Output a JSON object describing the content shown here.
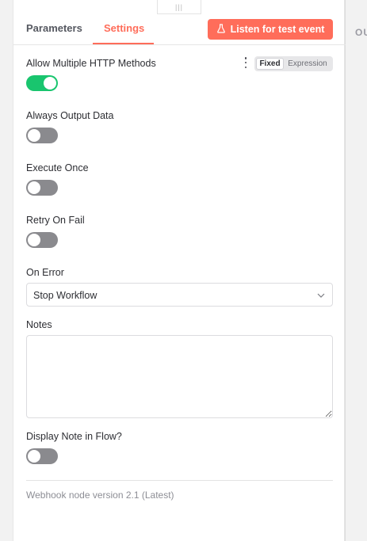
{
  "tabs": {
    "parameters": "Parameters",
    "settings": "Settings"
  },
  "listen_button": {
    "label": "Listen for test event",
    "icon": "flask-icon"
  },
  "mode_switch": {
    "fixed": "Fixed",
    "expression": "Expression",
    "selected": "Fixed"
  },
  "settings": {
    "allow_multiple_http_methods": {
      "label": "Allow Multiple HTTP Methods",
      "enabled": true
    },
    "always_output_data": {
      "label": "Always Output Data",
      "enabled": false
    },
    "execute_once": {
      "label": "Execute Once",
      "enabled": false
    },
    "retry_on_fail": {
      "label": "Retry On Fail",
      "enabled": false
    },
    "on_error": {
      "label": "On Error",
      "value": "Stop Workflow"
    },
    "notes": {
      "label": "Notes",
      "value": ""
    },
    "display_note_in_flow": {
      "label": "Display Note in Flow?",
      "enabled": false
    }
  },
  "footer": {
    "version_text": "Webhook node version 2.1 (Latest)"
  },
  "output_panel": {
    "label": "OU"
  },
  "colors": {
    "accent": "#ff6d5a",
    "toggle_on": "#19c56e",
    "toggle_off": "#8a8a8e"
  }
}
